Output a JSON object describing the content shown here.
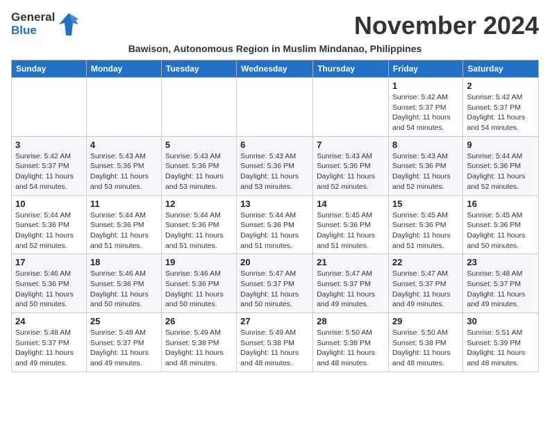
{
  "header": {
    "logo_general": "General",
    "logo_blue": "Blue",
    "month_title": "November 2024",
    "subtitle": "Bawison, Autonomous Region in Muslim Mindanao, Philippines"
  },
  "days_of_week": [
    "Sunday",
    "Monday",
    "Tuesday",
    "Wednesday",
    "Thursday",
    "Friday",
    "Saturday"
  ],
  "weeks": [
    [
      {
        "day": "",
        "info": ""
      },
      {
        "day": "",
        "info": ""
      },
      {
        "day": "",
        "info": ""
      },
      {
        "day": "",
        "info": ""
      },
      {
        "day": "",
        "info": ""
      },
      {
        "day": "1",
        "info": "Sunrise: 5:42 AM\nSunset: 5:37 PM\nDaylight: 11 hours and 54 minutes."
      },
      {
        "day": "2",
        "info": "Sunrise: 5:42 AM\nSunset: 5:37 PM\nDaylight: 11 hours and 54 minutes."
      }
    ],
    [
      {
        "day": "3",
        "info": "Sunrise: 5:42 AM\nSunset: 5:37 PM\nDaylight: 11 hours and 54 minutes."
      },
      {
        "day": "4",
        "info": "Sunrise: 5:43 AM\nSunset: 5:36 PM\nDaylight: 11 hours and 53 minutes."
      },
      {
        "day": "5",
        "info": "Sunrise: 5:43 AM\nSunset: 5:36 PM\nDaylight: 11 hours and 53 minutes."
      },
      {
        "day": "6",
        "info": "Sunrise: 5:43 AM\nSunset: 5:36 PM\nDaylight: 11 hours and 53 minutes."
      },
      {
        "day": "7",
        "info": "Sunrise: 5:43 AM\nSunset: 5:36 PM\nDaylight: 11 hours and 52 minutes."
      },
      {
        "day": "8",
        "info": "Sunrise: 5:43 AM\nSunset: 5:36 PM\nDaylight: 11 hours and 52 minutes."
      },
      {
        "day": "9",
        "info": "Sunrise: 5:44 AM\nSunset: 5:36 PM\nDaylight: 11 hours and 52 minutes."
      }
    ],
    [
      {
        "day": "10",
        "info": "Sunrise: 5:44 AM\nSunset: 5:36 PM\nDaylight: 11 hours and 52 minutes."
      },
      {
        "day": "11",
        "info": "Sunrise: 5:44 AM\nSunset: 5:36 PM\nDaylight: 11 hours and 51 minutes."
      },
      {
        "day": "12",
        "info": "Sunrise: 5:44 AM\nSunset: 5:36 PM\nDaylight: 11 hours and 51 minutes."
      },
      {
        "day": "13",
        "info": "Sunrise: 5:44 AM\nSunset: 5:36 PM\nDaylight: 11 hours and 51 minutes."
      },
      {
        "day": "14",
        "info": "Sunrise: 5:45 AM\nSunset: 5:36 PM\nDaylight: 11 hours and 51 minutes."
      },
      {
        "day": "15",
        "info": "Sunrise: 5:45 AM\nSunset: 5:36 PM\nDaylight: 11 hours and 51 minutes."
      },
      {
        "day": "16",
        "info": "Sunrise: 5:45 AM\nSunset: 5:36 PM\nDaylight: 11 hours and 50 minutes."
      }
    ],
    [
      {
        "day": "17",
        "info": "Sunrise: 5:46 AM\nSunset: 5:36 PM\nDaylight: 11 hours and 50 minutes."
      },
      {
        "day": "18",
        "info": "Sunrise: 5:46 AM\nSunset: 5:36 PM\nDaylight: 11 hours and 50 minutes."
      },
      {
        "day": "19",
        "info": "Sunrise: 5:46 AM\nSunset: 5:36 PM\nDaylight: 11 hours and 50 minutes."
      },
      {
        "day": "20",
        "info": "Sunrise: 5:47 AM\nSunset: 5:37 PM\nDaylight: 11 hours and 50 minutes."
      },
      {
        "day": "21",
        "info": "Sunrise: 5:47 AM\nSunset: 5:37 PM\nDaylight: 11 hours and 49 minutes."
      },
      {
        "day": "22",
        "info": "Sunrise: 5:47 AM\nSunset: 5:37 PM\nDaylight: 11 hours and 49 minutes."
      },
      {
        "day": "23",
        "info": "Sunrise: 5:48 AM\nSunset: 5:37 PM\nDaylight: 11 hours and 49 minutes."
      }
    ],
    [
      {
        "day": "24",
        "info": "Sunrise: 5:48 AM\nSunset: 5:37 PM\nDaylight: 11 hours and 49 minutes."
      },
      {
        "day": "25",
        "info": "Sunrise: 5:48 AM\nSunset: 5:37 PM\nDaylight: 11 hours and 49 minutes."
      },
      {
        "day": "26",
        "info": "Sunrise: 5:49 AM\nSunset: 5:38 PM\nDaylight: 11 hours and 48 minutes."
      },
      {
        "day": "27",
        "info": "Sunrise: 5:49 AM\nSunset: 5:38 PM\nDaylight: 11 hours and 48 minutes."
      },
      {
        "day": "28",
        "info": "Sunrise: 5:50 AM\nSunset: 5:38 PM\nDaylight: 11 hours and 48 minutes."
      },
      {
        "day": "29",
        "info": "Sunrise: 5:50 AM\nSunset: 5:38 PM\nDaylight: 11 hours and 48 minutes."
      },
      {
        "day": "30",
        "info": "Sunrise: 5:51 AM\nSunset: 5:39 PM\nDaylight: 11 hours and 48 minutes."
      }
    ]
  ]
}
